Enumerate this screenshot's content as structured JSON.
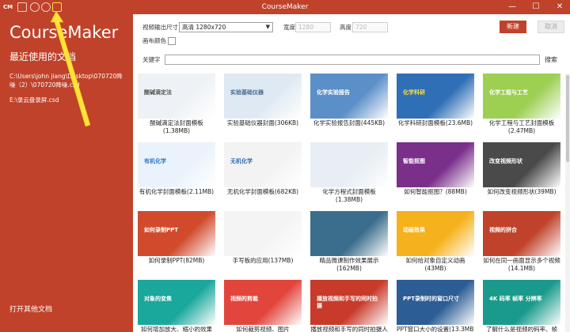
{
  "window": {
    "title": "CourseMaker",
    "logo": "CM",
    "min": "—",
    "max": "☐",
    "close": "✕"
  },
  "toolbar_icons": [
    "save-icon",
    "undo-icon",
    "redo-icon",
    "refresh-icon"
  ],
  "sidebar": {
    "brand": "CourseMaker",
    "recent_title": "最近使用的文档",
    "recent_files": [
      "C:\\Users\\john jiang\\Desktop\\070720降噪（2）\\070720降噪.csd",
      "E:\\录云盘录屏.csd"
    ],
    "open_other": "打开其他文档"
  },
  "settings": {
    "output_size_label": "视频输出尺寸",
    "output_size_value": "高清 1280x720",
    "width_label": "宽度",
    "width_value": "1280",
    "height_label": "高度",
    "height_value": "720",
    "bg_color_label": "画布颜色",
    "new_button": "新建",
    "cancel_button": "取消"
  },
  "search": {
    "label": "关键字",
    "value": "",
    "button": "搜索"
  },
  "templates": [
    {
      "caption": "酸碱滴定法封面模板",
      "caption2": "(1.38MB)",
      "thumb_text": "酸碱滴定法",
      "bg": "#eef2f6",
      "fg": "#555"
    },
    {
      "caption": "实验基础仪器封面(306KB)",
      "caption2": "",
      "thumb_text": "实验基础仪器",
      "bg": "#dfe9f3",
      "fg": "#4a6d95"
    },
    {
      "caption": "化学实验报告封面(445KB)",
      "caption2": "",
      "thumb_text": "化学实验报告",
      "bg": "#5b8fc7",
      "fg": "#ffffff"
    },
    {
      "caption": "化学科研封面模板(23.6MB)",
      "caption2": "",
      "thumb_text": "化学科研",
      "bg": "#2f6fb6",
      "fg": "#ffdf3a"
    },
    {
      "caption": "化学工程与工艺封面模板",
      "caption2": "(2.47MB)",
      "thumb_text": "化学工程与工艺",
      "bg": "#9ccf52",
      "fg": "#ffffff"
    },
    {
      "caption": "有机化学封面模板(2.11MB)",
      "caption2": "",
      "thumb_text": "有机化学",
      "bg": "#eaf3fb",
      "fg": "#2d7bc0"
    },
    {
      "caption": "无机化学封面模板(682KB)",
      "caption2": "",
      "thumb_text": "无机化学",
      "bg": "#f3f3f3",
      "fg": "#2f6fb6"
    },
    {
      "caption": "化学方程式封面模板",
      "caption2": "(1.38MB)",
      "thumb_text": "",
      "bg": "#e8eef4",
      "fg": "#555"
    },
    {
      "caption": "如何智能抠图？(88MB)",
      "caption2": "",
      "thumb_text": "智能抠图",
      "bg": "#7a2f8a",
      "fg": "#ffffff"
    },
    {
      "caption": "如何改变视频形状(39MB)",
      "caption2": "",
      "thumb_text": "改变视频形状",
      "bg": "#4a4a4a",
      "fg": "#ffffff"
    },
    {
      "caption": "如何录制PPT(82MB)",
      "caption2": "",
      "thumb_text": "如何录制PPT",
      "bg": "#d24a2c",
      "fg": "#ffffff"
    },
    {
      "caption": "手写板的应用(137MB)",
      "caption2": "",
      "thumb_text": "",
      "bg": "#f4f4f4",
      "fg": "#333"
    },
    {
      "caption": "精品微课制作效果展示",
      "caption2": "(162MB)",
      "thumb_text": "",
      "bg": "#3a6e8c",
      "fg": "#ffffff"
    },
    {
      "caption": "如何给对象自定义动画",
      "caption2": "(43MB)",
      "thumb_text": "动画效果",
      "bg": "#f6b21c",
      "fg": "#ffffff"
    },
    {
      "caption": "如何在同一画面显示多个视频",
      "caption2": "(14.1MB)",
      "thumb_text": "视频的拼合",
      "bg": "#c0422a",
      "fg": "#ffffff"
    },
    {
      "caption": "如何增加放大、缩小的效果",
      "caption2": "",
      "thumb_text": "对象的变焦",
      "bg": "#1aa79c",
      "fg": "#ffffff"
    },
    {
      "caption": "如何裁剪视频、图片",
      "caption2": "",
      "thumb_text": "视频的剪裁",
      "bg": "#e2453c",
      "fg": "#ffffff"
    },
    {
      "caption": "播放视频和手写的同时拍摄人",
      "caption2": "",
      "thumb_text": "播放视频和手写的同时拍摄",
      "bg": "#c83a2a",
      "fg": "#ffffff"
    },
    {
      "caption": "PPT窗口大小的设置(13.3MB)",
      "caption2": "",
      "thumb_text": "PPT录制时的窗口尺寸",
      "bg": "#2c5d94",
      "fg": "#ffffff"
    },
    {
      "caption": "了解什么是视频的码率、帧",
      "caption2": "",
      "thumb_text": "4K 码率 帧率 分辨率",
      "bg": "#1a9a8c",
      "fg": "#ffffff"
    }
  ],
  "colors": {
    "accent": "#c0422a",
    "highlight": "#ffe23a"
  }
}
